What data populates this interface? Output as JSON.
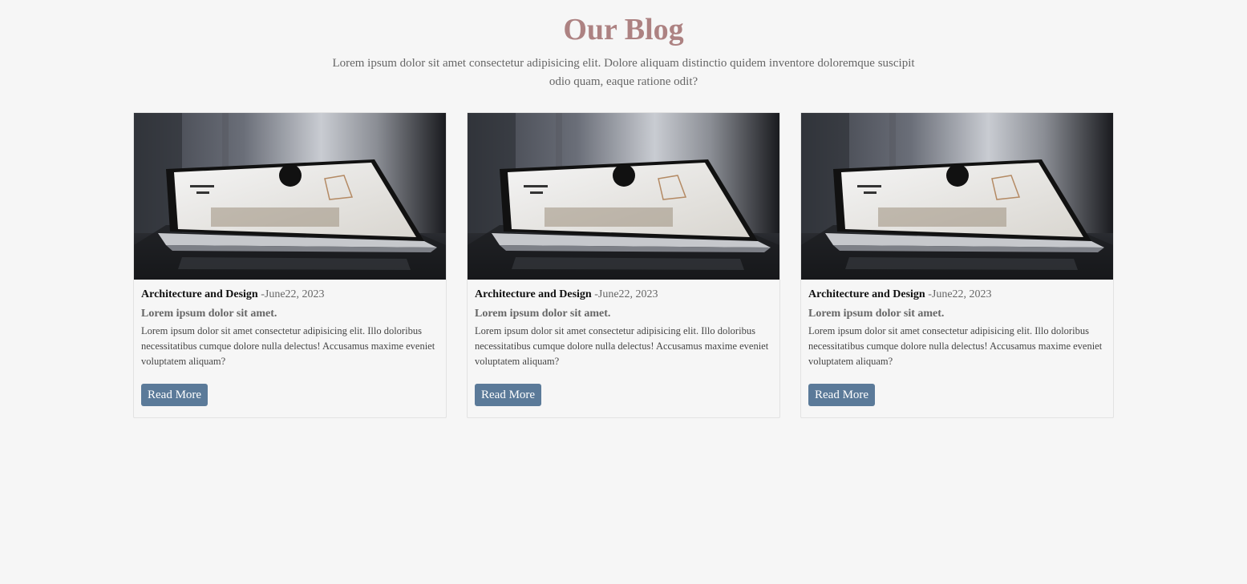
{
  "header": {
    "title": "Our Blog",
    "intro": "Lorem ipsum dolor sit amet consectetur adipisicing elit. Dolore aliquam distinctio quidem inventore doloremque suscipit odio quam, eaque ratione odit?"
  },
  "posts": [
    {
      "category": "Architecture and Design",
      "date": " -June22, 2023",
      "title": "Lorem ipsum dolor sit amet.",
      "excerpt": "Lorem ipsum dolor sit amet consectetur adipisicing elit. Illo doloribus necessitatibus cumque dolore nulla delectus! Accusamus maxime eveniet voluptatem aliquam?",
      "button_label": "Read More"
    },
    {
      "category": "Architecture and Design",
      "date": " -June22, 2023",
      "title": "Lorem ipsum dolor sit amet.",
      "excerpt": "Lorem ipsum dolor sit amet consectetur adipisicing elit. Illo doloribus necessitatibus cumque dolore nulla delectus! Accusamus maxime eveniet voluptatem aliquam?",
      "button_label": "Read More"
    },
    {
      "category": "Architecture and Design",
      "date": " -June22, 2023",
      "title": "Lorem ipsum dolor sit amet.",
      "excerpt": "Lorem ipsum dolor sit amet consectetur adipisicing elit. Illo doloribus necessitatibus cumque dolore nulla delectus! Accusamus maxime eveniet voluptatem aliquam?",
      "button_label": "Read More"
    }
  ],
  "colors": {
    "title": "#ad8282",
    "button": "#5b7a99",
    "background": "#f6f6f6"
  }
}
